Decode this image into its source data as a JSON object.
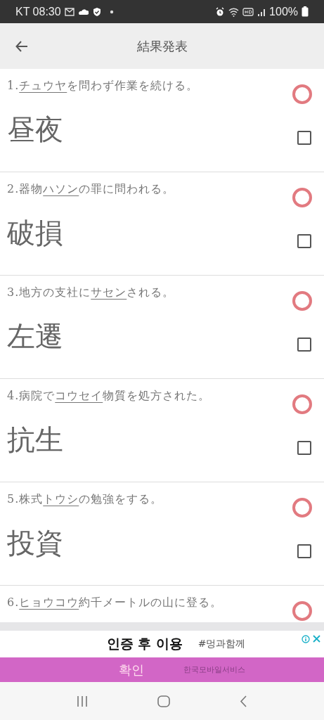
{
  "status_bar": {
    "carrier_time": "KT 08:30",
    "battery": "100%"
  },
  "app_bar": {
    "title": "結果発表"
  },
  "questions": [
    {
      "number": "1.",
      "underlined": "チュウヤ",
      "after": "を問わず作業を続ける。",
      "answer": "昼夜",
      "kind": "correct",
      "checked": false
    },
    {
      "number": "2.",
      "before": "器物",
      "underlined": "ハソン",
      "after": "の罪に問われる。",
      "answer": "破損",
      "kind": "correct",
      "checked": false
    },
    {
      "number": "3.",
      "before": "地方の支社に",
      "underlined": "サセン",
      "after": "される。",
      "answer": "左遷",
      "kind": "correct",
      "checked": false
    },
    {
      "number": "4.",
      "before": "病院で",
      "underlined": "コウセイ",
      "after": "物質を処方された。",
      "answer": "抗生",
      "kind": "correct",
      "checked": false
    },
    {
      "number": "5.",
      "before": "株式",
      "underlined": "トウシ",
      "after": "の勉強をする。",
      "answer": "投資",
      "kind": "correct",
      "checked": false
    },
    {
      "number": "6.",
      "underlined": "ヒョウコウ",
      "after": "約千メートルの山に登る。",
      "kind": "correct"
    }
  ],
  "ad": {
    "headline": "인증 후 이용",
    "tag": "#멍과함께",
    "button": "확인",
    "advertiser": "한국모바일서비스"
  }
}
